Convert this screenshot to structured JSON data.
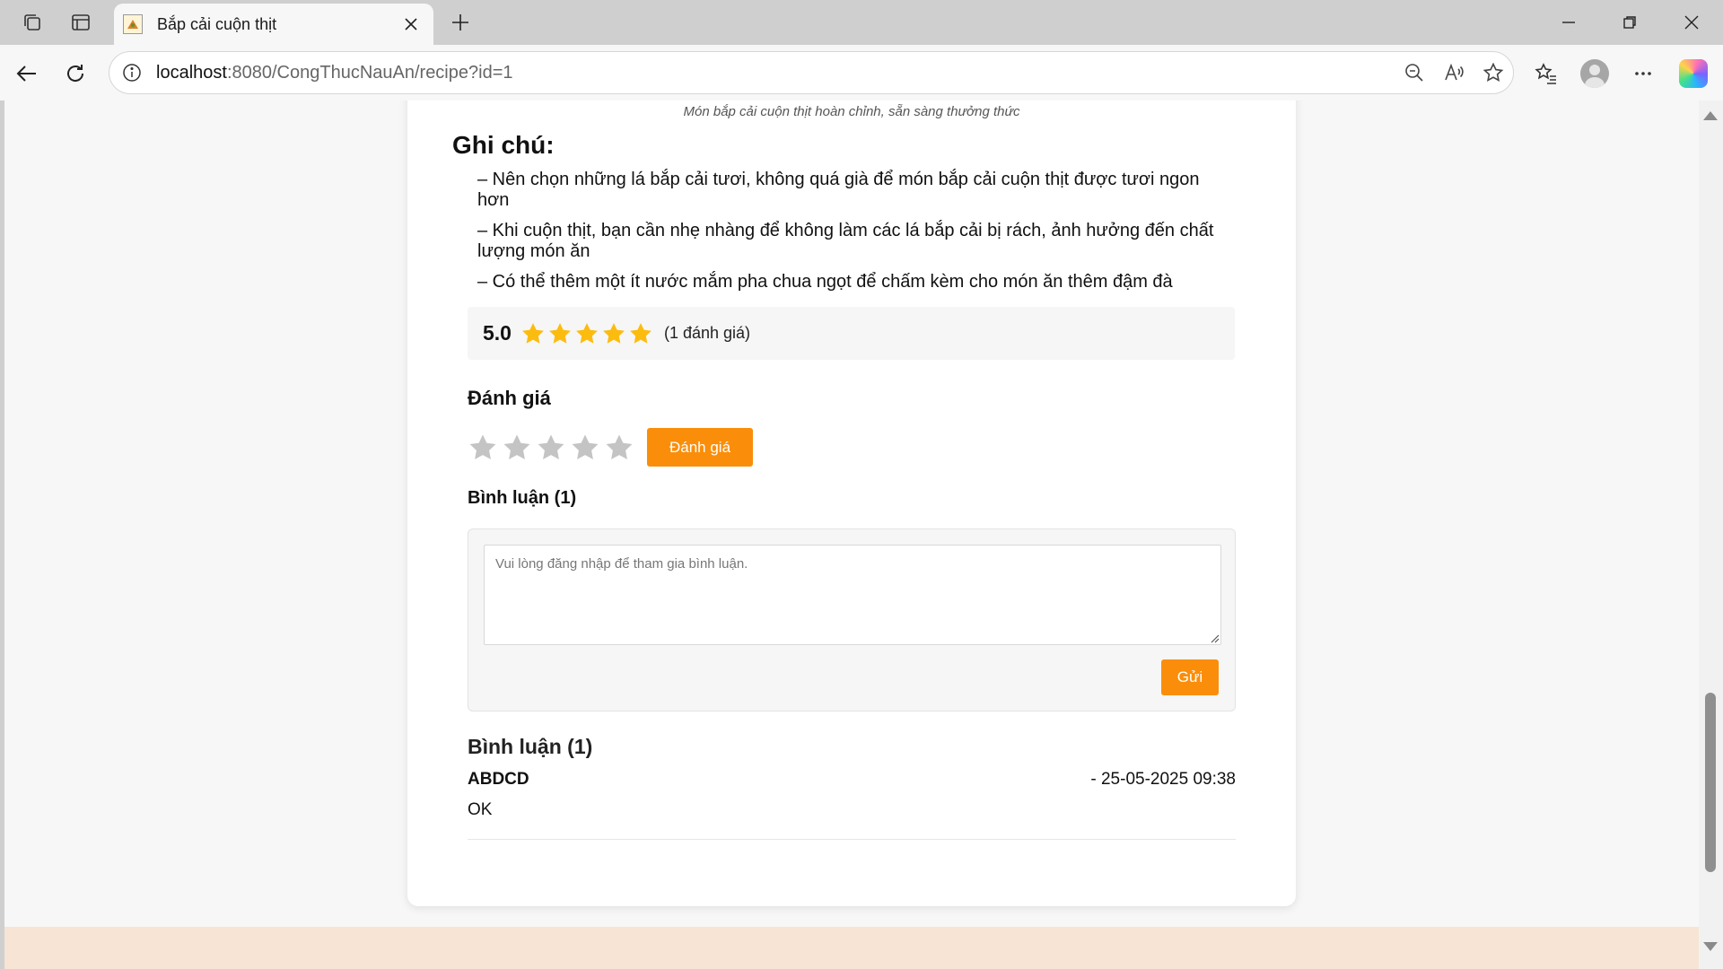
{
  "browser": {
    "tab_title": "Bắp cải cuộn thịt",
    "url_host": "localhost",
    "url_rest": ":8080/CongThucNauAn/recipe?id=1"
  },
  "recipe": {
    "image_caption": "Món bắp cải cuộn thịt hoàn chỉnh, sẵn sàng thưởng thức",
    "notes_title": "Ghi chú:",
    "notes": [
      "– Nên chọn những lá bắp cải tươi, không quá già để món bắp cải cuộn thịt được tươi ngon hơn",
      "– Khi cuộn thịt, bạn cần nhẹ nhàng để không làm các lá bắp cải bị rách, ảnh hưởng đến chất lượng món ăn",
      "– Có thể thêm một ít nước mắm pha chua ngọt để chấm kèm cho món ăn thêm đậm đà"
    ]
  },
  "rating_summary": {
    "score": "5.0",
    "stars_filled": 5,
    "stars_total": 5,
    "count_label": "(1 đánh giá)"
  },
  "rate": {
    "title": "Đánh giá",
    "button_label": "Đánh giá",
    "selected_stars": 0
  },
  "comment_form": {
    "heading": "Bình luận (1)",
    "placeholder": "Vui lòng đăng nhập để tham gia bình luận.",
    "value": "",
    "send_label": "Gửi"
  },
  "comments": {
    "title": "Bình luận (1)",
    "items": [
      {
        "author": "ABDCD",
        "time": "- 25-05-2025 09:38",
        "text": "OK"
      }
    ]
  },
  "colors": {
    "accent": "#fa8e0a",
    "star_filled": "#fcbc0f",
    "star_empty": "#c4c4c4",
    "footer": "#f7e4d5"
  }
}
